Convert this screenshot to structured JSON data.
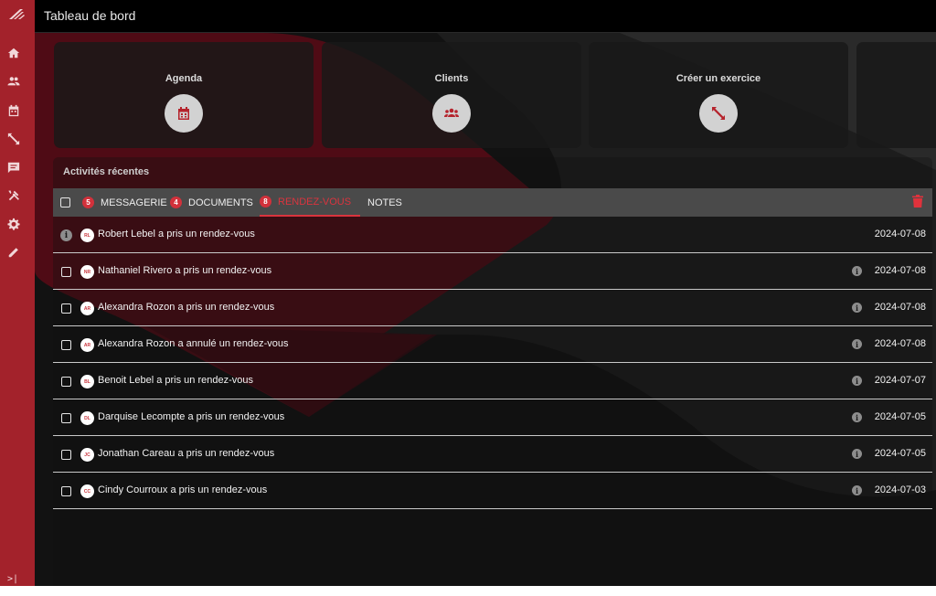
{
  "header": {
    "title": "Tableau de bord"
  },
  "sidebar": {
    "items": [
      {
        "icon": "home-icon"
      },
      {
        "icon": "users-icon"
      },
      {
        "icon": "calendar-icon"
      },
      {
        "icon": "exercise-icon"
      },
      {
        "icon": "chat-icon"
      },
      {
        "icon": "tools-icon"
      },
      {
        "icon": "gear-icon"
      },
      {
        "icon": "pencil-icon"
      }
    ],
    "collapse_label": ">|"
  },
  "cards": [
    {
      "label": "Agenda",
      "icon": "calendar-icon"
    },
    {
      "label": "Clients",
      "icon": "group-icon"
    },
    {
      "label": "Créer un exercice",
      "icon": "resize-icon"
    }
  ],
  "activity": {
    "title": "Activités récentes",
    "tabs": [
      {
        "label": "MESSAGERIE",
        "count": "5"
      },
      {
        "label": "DOCUMENTS",
        "count": "4"
      },
      {
        "label": "RENDEZ-VOUS",
        "count": "8"
      },
      {
        "label": "NOTES",
        "count": ""
      }
    ],
    "rows": [
      {
        "initials": "RL",
        "text": "Robert Lebel a pris un rendez-vous",
        "date": "2024-07-08"
      },
      {
        "initials": "NR",
        "text": "Nathaniel Rivero a pris un rendez-vous",
        "date": "2024-07-08"
      },
      {
        "initials": "AR",
        "text": "Alexandra Rozon a pris un rendez-vous",
        "date": "2024-07-08"
      },
      {
        "initials": "AR",
        "text": "Alexandra Rozon a annulé un rendez-vous",
        "date": "2024-07-08"
      },
      {
        "initials": "BL",
        "text": "Benoit Lebel a pris un rendez-vous",
        "date": "2024-07-07"
      },
      {
        "initials": "DL",
        "text": "Darquise Lecompte a pris un rendez-vous",
        "date": "2024-07-05"
      },
      {
        "initials": "JC",
        "text": "Jonathan Careau a pris un rendez-vous",
        "date": "2024-07-05"
      },
      {
        "initials": "CC",
        "text": "Cindy Courroux a pris un rendez-vous",
        "date": "2024-07-03"
      }
    ]
  },
  "colors": {
    "accent": "#a3222b",
    "badge": "#d2313b",
    "background": "#121212"
  }
}
